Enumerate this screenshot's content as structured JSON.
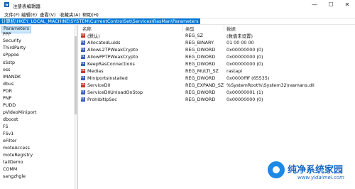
{
  "window": {
    "title": "注册表编辑器",
    "minimize": "—",
    "maximize": "☐",
    "close": "✕"
  },
  "menu": [
    "文件(F)",
    "编辑(E)",
    "查看(V)",
    "收藏夹(A)",
    "帮助(H)"
  ],
  "address": "计算机\\HKEY_LOCAL_MACHINE\\SYSTEM\\CurrentControlSet\\Services\\RasMan\\Parameters",
  "tree": [
    {
      "label": "Parameters",
      "selected": true
    },
    {
      "label": "PPP"
    },
    {
      "label": "Security"
    },
    {
      "label": "ThirdParty"
    },
    {
      "label": "sPppoe"
    },
    {
      "label": "sSstp"
    },
    {
      "label": "oss"
    },
    {
      "label": "IMANDK"
    },
    {
      "label": "dbus"
    },
    {
      "label": "PDR"
    },
    {
      "label": "PNP"
    },
    {
      "label": "PUDD"
    },
    {
      "label": "pVideoMiniport"
    },
    {
      "label": "dboost"
    },
    {
      "label": "FS"
    },
    {
      "label": "FSv1"
    },
    {
      "label": "eFilter"
    },
    {
      "label": "moteAccess"
    },
    {
      "label": "moteRegistry"
    },
    {
      "label": "tailDemo"
    },
    {
      "label": "COMM"
    },
    {
      "label": "sangzhgle"
    }
  ],
  "list": {
    "headers": {
      "name": "名称",
      "type": "类型",
      "data": "数据"
    },
    "rows": [
      {
        "icon": "string-value-icon",
        "name": "(默认)",
        "type": "REG_SZ",
        "data": "(数值未设置)"
      },
      {
        "icon": "binary-value-icon",
        "name": "AllocatedLuids",
        "type": "REG_BINARY",
        "data": "01 00 00 00"
      },
      {
        "icon": "binary-value-icon",
        "name": "AllowL2TPWeakCrypto",
        "type": "REG_DWORD",
        "data": "0x00000000 (0)"
      },
      {
        "icon": "binary-value-icon",
        "name": "AllowPPTPWeakCrypto",
        "type": "REG_DWORD",
        "data": "0x00000000 (0)"
      },
      {
        "icon": "binary-value-icon",
        "name": "KeepRasConnections",
        "type": "REG_DWORD",
        "data": "0x00000000 (0)"
      },
      {
        "icon": "string-value-icon",
        "name": "Medias",
        "type": "REG_MULTI_SZ",
        "data": "rastapi"
      },
      {
        "icon": "binary-value-icon",
        "name": "MiniportsInstalled",
        "type": "REG_DWORD",
        "data": "0x0000ffff (65535)"
      },
      {
        "icon": "string-value-icon",
        "name": "ServiceDll",
        "type": "REG_EXPAND_SZ",
        "data": "%SystemRoot%\\System32\\rasmans.dll"
      },
      {
        "icon": "binary-value-icon",
        "name": "ServiceDllUnloadOnStop",
        "type": "REG_DWORD",
        "data": "0x00000001 (1)"
      },
      {
        "icon": "binary-value-icon",
        "name": "ProhibitIpSec",
        "type": "REG_DWORD",
        "data": "0x00000000 (0)"
      }
    ]
  },
  "watermark": {
    "text": "纯净系统家园",
    "url": "www.yidaimei.com",
    "color": "#1565c0"
  }
}
